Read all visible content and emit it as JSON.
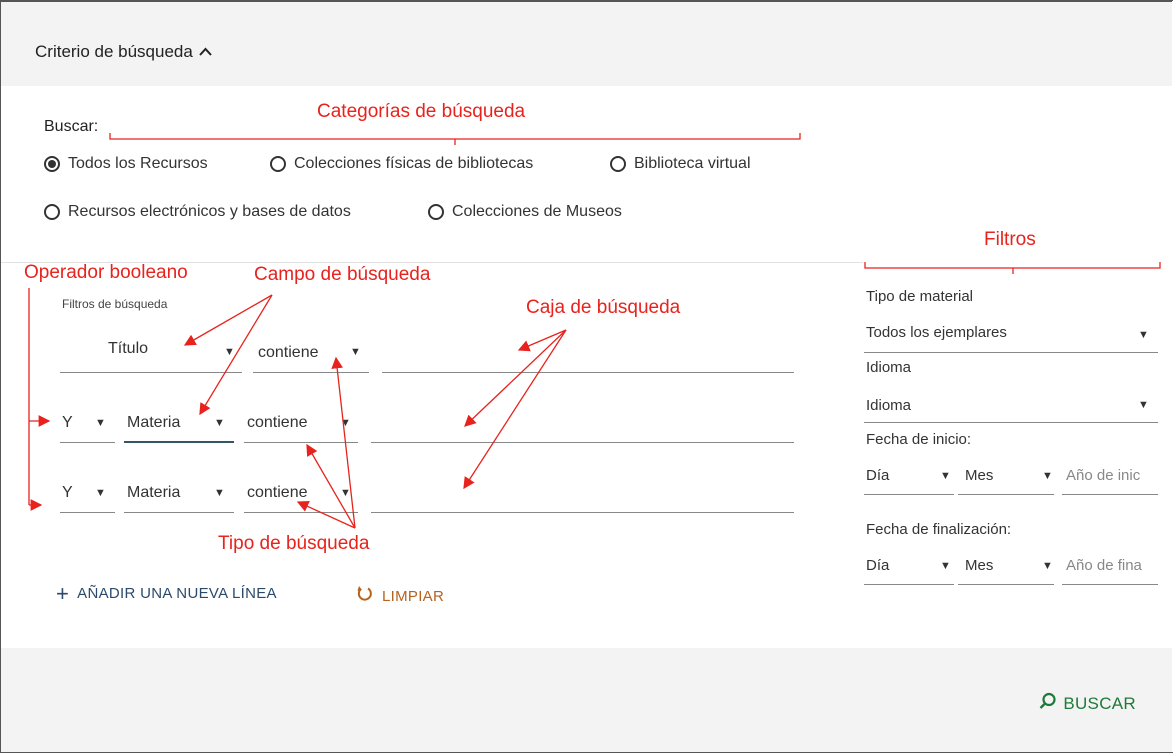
{
  "header": {
    "title": "Criterio de búsqueda",
    "chevron_icon": "chevron-up-icon"
  },
  "search": {
    "buscar_label": "Buscar:",
    "categories": [
      {
        "label": "Todos los Recursos",
        "checked": true
      },
      {
        "label": "Colecciones físicas de bibliotecas",
        "checked": false
      },
      {
        "label": "Biblioteca virtual",
        "checked": false
      },
      {
        "label": "Recursos electrónicos y bases de datos",
        "checked": false
      },
      {
        "label": "Colecciones de Museos",
        "checked": false
      }
    ],
    "filters_label": "Filtros de búsqueda",
    "rows": [
      {
        "operator": "",
        "field": "Título",
        "type": "contiene",
        "query": ""
      },
      {
        "operator": "Y",
        "field": "Materia",
        "type": "contiene",
        "query": ""
      },
      {
        "operator": "Y",
        "field": "Materia",
        "type": "contiene",
        "query": ""
      }
    ],
    "add_line": "AÑADIR UNA NUEVA LÍNEA",
    "clear": "LIMPIAR"
  },
  "sidebar": {
    "material_label": "Tipo de material",
    "material_value": "Todos los ejemplares",
    "language_label": "Idioma",
    "language_value": "Idioma",
    "start_label": "Fecha de inicio:",
    "start_day": "Día",
    "start_month": "Mes",
    "start_year_placeholder": "Año de inic",
    "end_label": "Fecha de finalización:",
    "end_day": "Día",
    "end_month": "Mes",
    "end_year_placeholder": "Año de fina"
  },
  "footer": {
    "search_button": "BUSCAR"
  },
  "annotations": {
    "categories": "Categorías de búsqueda",
    "filters": "Filtros",
    "boolean": "Operador booleano",
    "field": "Campo de búsqueda",
    "box": "Caja de búsqueda",
    "type": "Tipo de búsqueda"
  },
  "colors": {
    "annotation": "#e8231d",
    "search_button": "#1f7a3a",
    "clear": "#b5621f",
    "add": "#2b4a6a"
  }
}
